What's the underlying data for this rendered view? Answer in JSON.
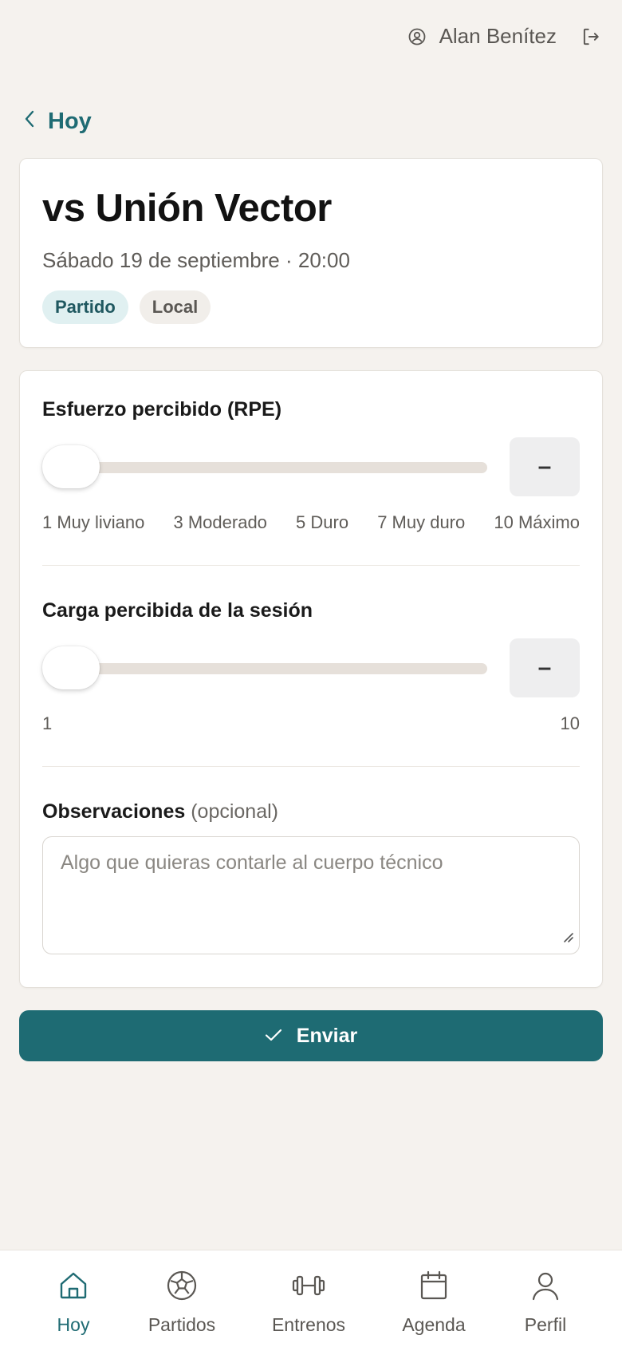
{
  "header": {
    "user_name": "Alan Benítez",
    "account_icon": "account-circle-icon",
    "logout_icon": "logout-icon"
  },
  "back": {
    "label": "Hoy",
    "icon": "chevron-left-icon"
  },
  "event": {
    "title": "vs Unión Vector",
    "datetime": "Sábado 19 de septiembre · 20:00",
    "tags": [
      "Partido",
      "Local"
    ]
  },
  "rpe": {
    "label": "Esfuerzo percibido (RPE)",
    "value_display": "–",
    "slider_level": 0,
    "scale_labels": [
      "1 Muy liviano",
      "3 Moderado",
      "5 Duro",
      "7 Muy duro",
      "10 Máximo"
    ]
  },
  "carga": {
    "label": "Carga percibida de la sesión",
    "value_display": "–",
    "slider_level": 0,
    "min_label": "1",
    "max_label": "10"
  },
  "observaciones": {
    "label": "Observaciones",
    "optional_label": "(opcional)",
    "placeholder": "Algo que quieras contarle al cuerpo técnico",
    "value": ""
  },
  "submit": {
    "label": "Enviar",
    "icon": "check-icon"
  },
  "bottom_nav": {
    "active": "Hoy",
    "items": [
      {
        "label": "Hoy",
        "icon": "home-icon"
      },
      {
        "label": "Partidos",
        "icon": "soccer-ball-icon"
      },
      {
        "label": "Entrenos",
        "icon": "dumbbell-icon"
      },
      {
        "label": "Agenda",
        "icon": "calendar-icon"
      },
      {
        "label": "Perfil",
        "icon": "user-icon"
      }
    ]
  },
  "colors": {
    "accent": "#1e6b73",
    "background": "#f5f2ee",
    "tag_partido_bg": "#e0f0f1",
    "tag_local_bg": "#f1eeea"
  }
}
